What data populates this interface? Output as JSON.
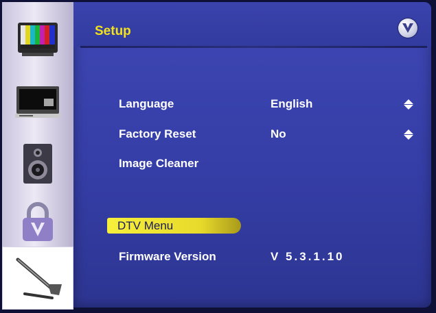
{
  "sidebar": {
    "items": [
      {
        "icon": "tv-color-bars-icon"
      },
      {
        "icon": "monitor-icon"
      },
      {
        "icon": "speaker-icon"
      },
      {
        "icon": "padlock-v-icon"
      },
      {
        "icon": "wrench-icon",
        "selected": true
      }
    ]
  },
  "header": {
    "title": "Setup",
    "logo_icon": "vizio-v-logo"
  },
  "menu": {
    "language": {
      "label": "Language",
      "value": "English"
    },
    "factory_reset": {
      "label": "Factory Reset",
      "value": "No"
    },
    "image_cleaner": {
      "label": "Image Cleaner"
    },
    "dtv_menu": {
      "label": "DTV Menu"
    },
    "firmware": {
      "label": "Firmware Version",
      "value": "V  5.3.1.10"
    }
  },
  "colors": {
    "accent_yellow": "#f2e11b",
    "panel_blue": "#3a43ad",
    "text_white": "#ffffff",
    "highlight": "#f6ef3c"
  }
}
